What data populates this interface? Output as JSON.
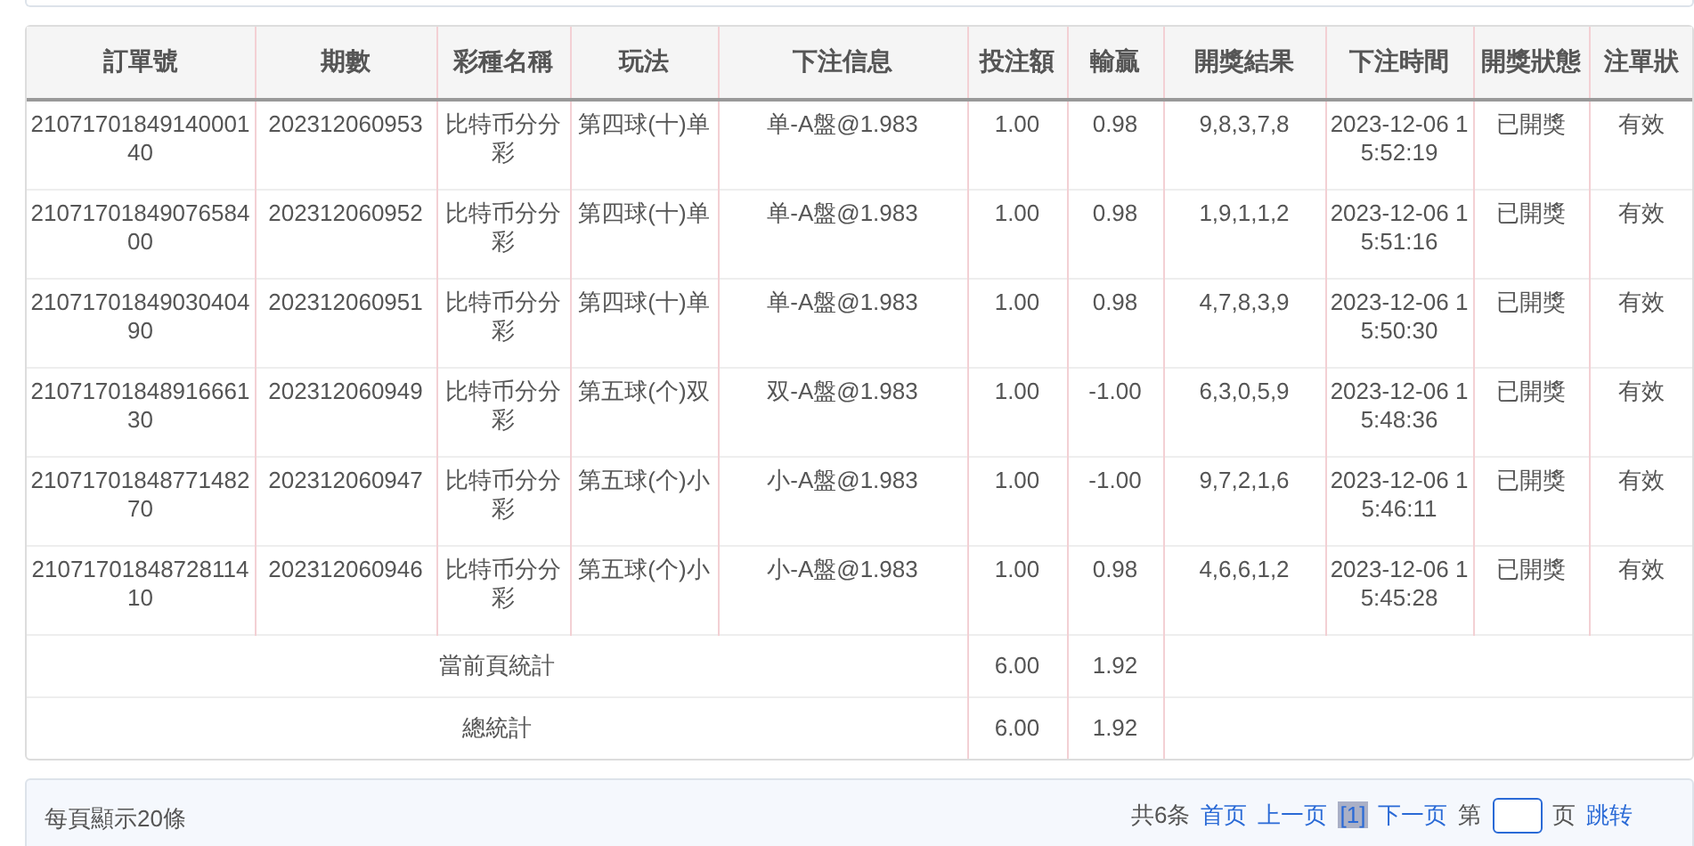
{
  "table": {
    "columns": [
      "訂單號",
      "期數",
      "彩種名稱",
      "玩法",
      "下注信息",
      "投注額",
      "輸贏",
      "開獎結果",
      "下注時間",
      "開獎狀態",
      "注單狀"
    ],
    "rows": [
      {
        "cells": [
          "2107170184914000140",
          "202312060953",
          "比特币分分彩",
          "第四球(十)单",
          "单-A盤@1.983",
          "1.00",
          "0.98",
          "9,8,3,7,8",
          "2023-12-06 15:52:19",
          "已開獎",
          "有效"
        ]
      },
      {
        "cells": [
          "2107170184907658400",
          "202312060952",
          "比特币分分彩",
          "第四球(十)单",
          "单-A盤@1.983",
          "1.00",
          "0.98",
          "1,9,1,1,2",
          "2023-12-06 15:51:16",
          "已開獎",
          "有效"
        ]
      },
      {
        "cells": [
          "2107170184903040490",
          "202312060951",
          "比特币分分彩",
          "第四球(十)单",
          "单-A盤@1.983",
          "1.00",
          "0.98",
          "4,7,8,3,9",
          "2023-12-06 15:50:30",
          "已開獎",
          "有效"
        ]
      },
      {
        "cells": [
          "2107170184891666130",
          "202312060949",
          "比特币分分彩",
          "第五球(个)双",
          "双-A盤@1.983",
          "1.00",
          "-1.00",
          "6,3,0,5,9",
          "2023-12-06 15:48:36",
          "已開獎",
          "有效"
        ]
      },
      {
        "cells": [
          "2107170184877148270",
          "202312060947",
          "比特币分分彩",
          "第五球(个)小",
          "小-A盤@1.983",
          "1.00",
          "-1.00",
          "9,7,2,1,6",
          "2023-12-06 15:46:11",
          "已開獎",
          "有效"
        ]
      },
      {
        "cells": [
          "2107170184872811410",
          "202312060946",
          "比特币分分彩",
          "第五球(个)小",
          "小-A盤@1.983",
          "1.00",
          "0.98",
          "4,6,6,1,2",
          "2023-12-06 15:45:28",
          "已開獎",
          "有效"
        ]
      }
    ],
    "summaries": [
      {
        "label": "當前頁統計",
        "amount": "6.00",
        "result": "1.92"
      },
      {
        "label": "總統計",
        "amount": "6.00",
        "result": "1.92"
      }
    ]
  },
  "footer": {
    "per_page": "每頁顯示20條",
    "pagination": {
      "total": "共6条",
      "first": "首页",
      "prev": "上一页",
      "pages": [
        {
          "label": "[1]",
          "selected": true
        }
      ],
      "next": "下一页",
      "goto_prefix": "第",
      "goto_suffix": "页",
      "goto_button": "跳转"
    }
  }
}
